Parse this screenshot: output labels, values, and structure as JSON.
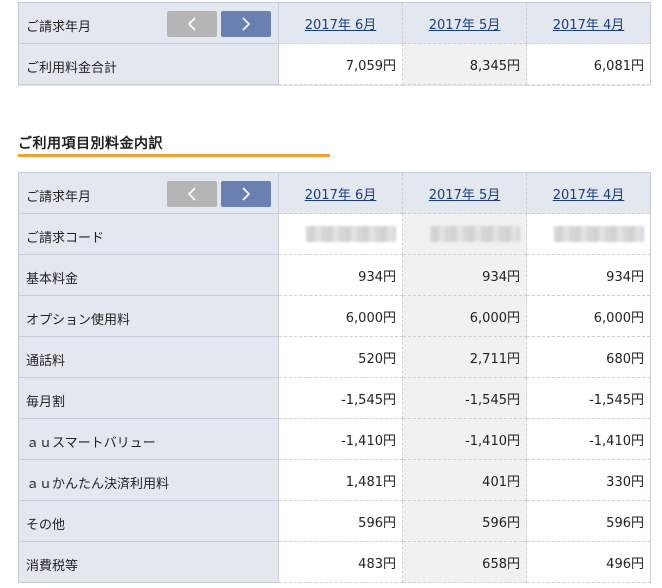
{
  "summary": {
    "header_label": "ご請求年月",
    "months": [
      "2017年 6月",
      "2017年 5月",
      "2017年 4月"
    ],
    "rows": [
      {
        "label": "ご利用料金合計",
        "values": [
          "7,059円",
          "8,345円",
          "6,081円"
        ]
      }
    ]
  },
  "breakdown": {
    "title": "ご利用項目別料金内訳",
    "header_label": "ご請求年月",
    "months": [
      "2017年 6月",
      "2017年 5月",
      "2017年 4月"
    ],
    "code_label": "ご請求コード",
    "rows": [
      {
        "label": "基本料金",
        "values": [
          "934円",
          "934円",
          "934円"
        ]
      },
      {
        "label": "オプション使用料",
        "values": [
          "6,000円",
          "6,000円",
          "6,000円"
        ]
      },
      {
        "label": "通話料",
        "values": [
          "520円",
          "2,711円",
          "680円"
        ]
      },
      {
        "label": "毎月割",
        "values": [
          "-1,545円",
          "-1,545円",
          "-1,545円"
        ]
      },
      {
        "label": "ａｕスマートバリュー",
        "values": [
          "-1,410円",
          "-1,410円",
          "-1,410円"
        ]
      },
      {
        "label": "ａｕかんたん決済利用料",
        "values": [
          "1,481円",
          "401円",
          "330円"
        ]
      },
      {
        "label": "その他",
        "values": [
          "596円",
          "596円",
          "596円"
        ]
      },
      {
        "label": "消費税等",
        "values": [
          "483円",
          "658円",
          "496円"
        ]
      }
    ]
  },
  "icons": {
    "prev": "chevron-left-icon",
    "next": "chevron-right-icon"
  }
}
